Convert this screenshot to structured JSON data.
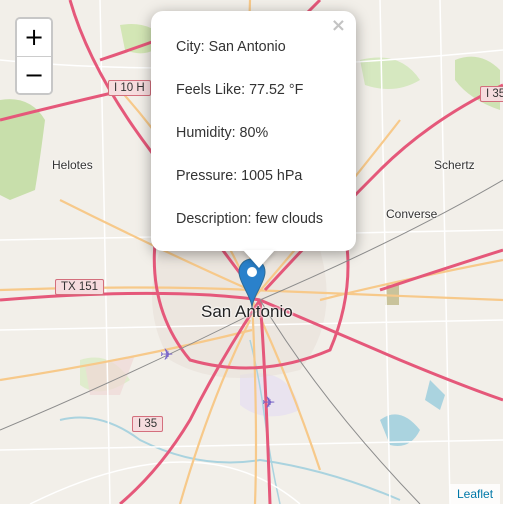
{
  "zoom": {
    "in_label": "+",
    "out_label": "−"
  },
  "popup": {
    "close_label": "×",
    "lines": [
      "City: San Antonio",
      "Feels Like: 77.52 °F",
      "Humidity: 80%",
      "Pressure: 1005 hPa",
      "Description: few clouds"
    ]
  },
  "map_labels": {
    "main_city": "San Antonio",
    "helotes": "Helotes",
    "schertz": "Schertz",
    "converse": "Converse"
  },
  "shields": {
    "i10": "I 10 H",
    "i35_ne": "I 35",
    "tx151": "TX 151",
    "i35_s": "I 35"
  },
  "attribution": "Leaflet",
  "colors": {
    "marker": "#2a81cb",
    "link": "#0078a8"
  }
}
